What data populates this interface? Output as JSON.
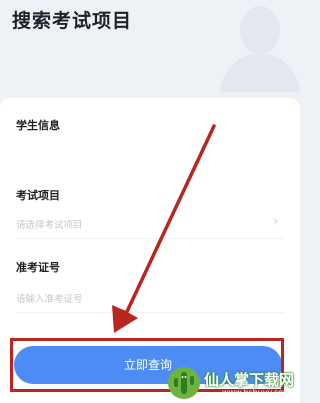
{
  "header": {
    "title": "搜索考试项目"
  },
  "form": {
    "student_section_label": "学生信息",
    "exam_item": {
      "label": "考试项目",
      "placeholder": "请选择考试项目"
    },
    "ticket_number": {
      "label": "准考证号",
      "placeholder": "请输入准考证号"
    },
    "submit_label": "立即查询"
  },
  "watermark": {
    "text": "仙人掌下载网",
    "url": "www.hshuyy.com"
  },
  "colors": {
    "accent_button": "#4d8cf5",
    "annotation_red": "#b8261f",
    "page_background": "#eef1f6"
  },
  "icons": [
    "chevron-right-icon",
    "cactus-logo-icon"
  ]
}
